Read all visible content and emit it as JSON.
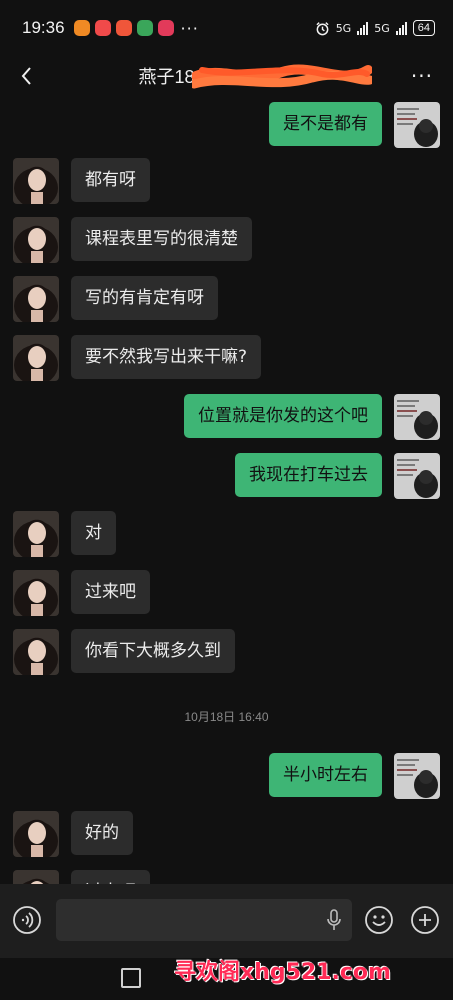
{
  "status_bar": {
    "time": "19:36",
    "more": "···",
    "network_1": "5G",
    "network_2": "5G",
    "battery": "64"
  },
  "header": {
    "title": "燕子18",
    "more": "···"
  },
  "messages": [
    {
      "side": "right",
      "text": "是不是都有"
    },
    {
      "side": "left",
      "text": "都有呀"
    },
    {
      "side": "left",
      "text": "课程表里写的很清楚"
    },
    {
      "side": "left",
      "text": "写的有肯定有呀"
    },
    {
      "side": "left",
      "text": "要不然我写出来干嘛?"
    },
    {
      "side": "right",
      "text": "位置就是你发的这个吧"
    },
    {
      "side": "right",
      "text": "我现在打车过去"
    },
    {
      "side": "left",
      "text": "对"
    },
    {
      "side": "left",
      "text": "过来吧"
    },
    {
      "side": "left",
      "text": "你看下大概多久到"
    },
    {
      "side": "right",
      "text": "半小时左右"
    },
    {
      "side": "left",
      "text": "好的"
    },
    {
      "side": "left",
      "text": "过来吧"
    }
  ],
  "timestamp": "10月18日 16:40",
  "watermark": "寻欢阁xhg521.com",
  "colors": {
    "background": "#111111",
    "sent_bubble": "#3eb575",
    "received_bubble": "#2c2c2c",
    "watermark": "#ff2a55"
  }
}
